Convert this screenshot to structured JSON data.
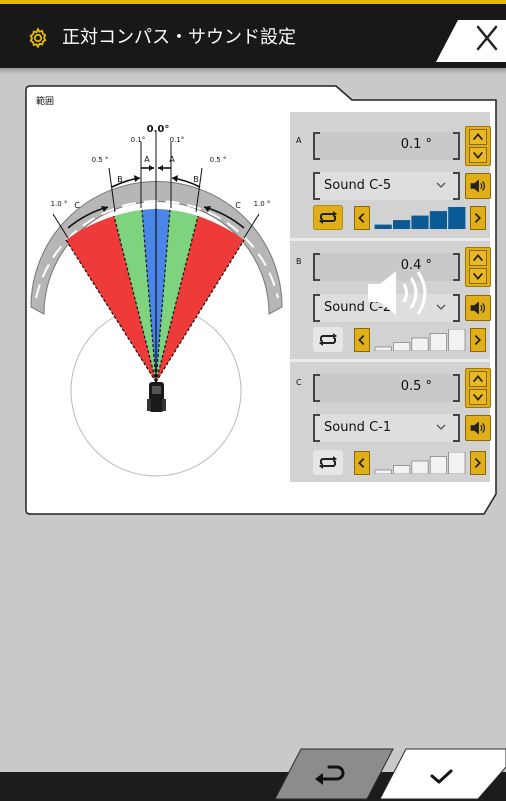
{
  "header": {
    "title": "正対コンパス・サウンド設定",
    "close_label": "×"
  },
  "card": {
    "range_label": "範囲"
  },
  "diagram": {
    "center_label": "0.0°",
    "labels": {
      "a_left_value": "0.1°",
      "a_right_value": "0.1°",
      "b_left_value": "0.5 °",
      "b_right_value": "0.5 °",
      "c_left_value": "1.0 °",
      "c_right_value": "1.0 °",
      "a_left": "A",
      "a_right": "A",
      "b_left": "B",
      "b_right": "B",
      "c_left": "C",
      "c_right": "C"
    },
    "colors": {
      "zone_a": "#4a86e8",
      "zone_b": "#7ed37e",
      "zone_c": "#ef3a3a"
    }
  },
  "sections": [
    {
      "label": "A",
      "value": "0.1 °",
      "sound": "Sound C-5",
      "volume_level": 5,
      "volume_max": 5,
      "loop_active": true
    },
    {
      "label": "B",
      "value": "0.4 °",
      "sound": "Sound C-2",
      "volume_level": 0,
      "volume_max": 5,
      "loop_active": false
    },
    {
      "label": "C",
      "value": "0.5 °",
      "sound": "Sound C-1",
      "volume_level": 0,
      "volume_max": 5,
      "loop_active": false
    }
  ],
  "footer": {
    "back_icon": "return-arrow-icon",
    "ok_icon": "check-icon"
  }
}
